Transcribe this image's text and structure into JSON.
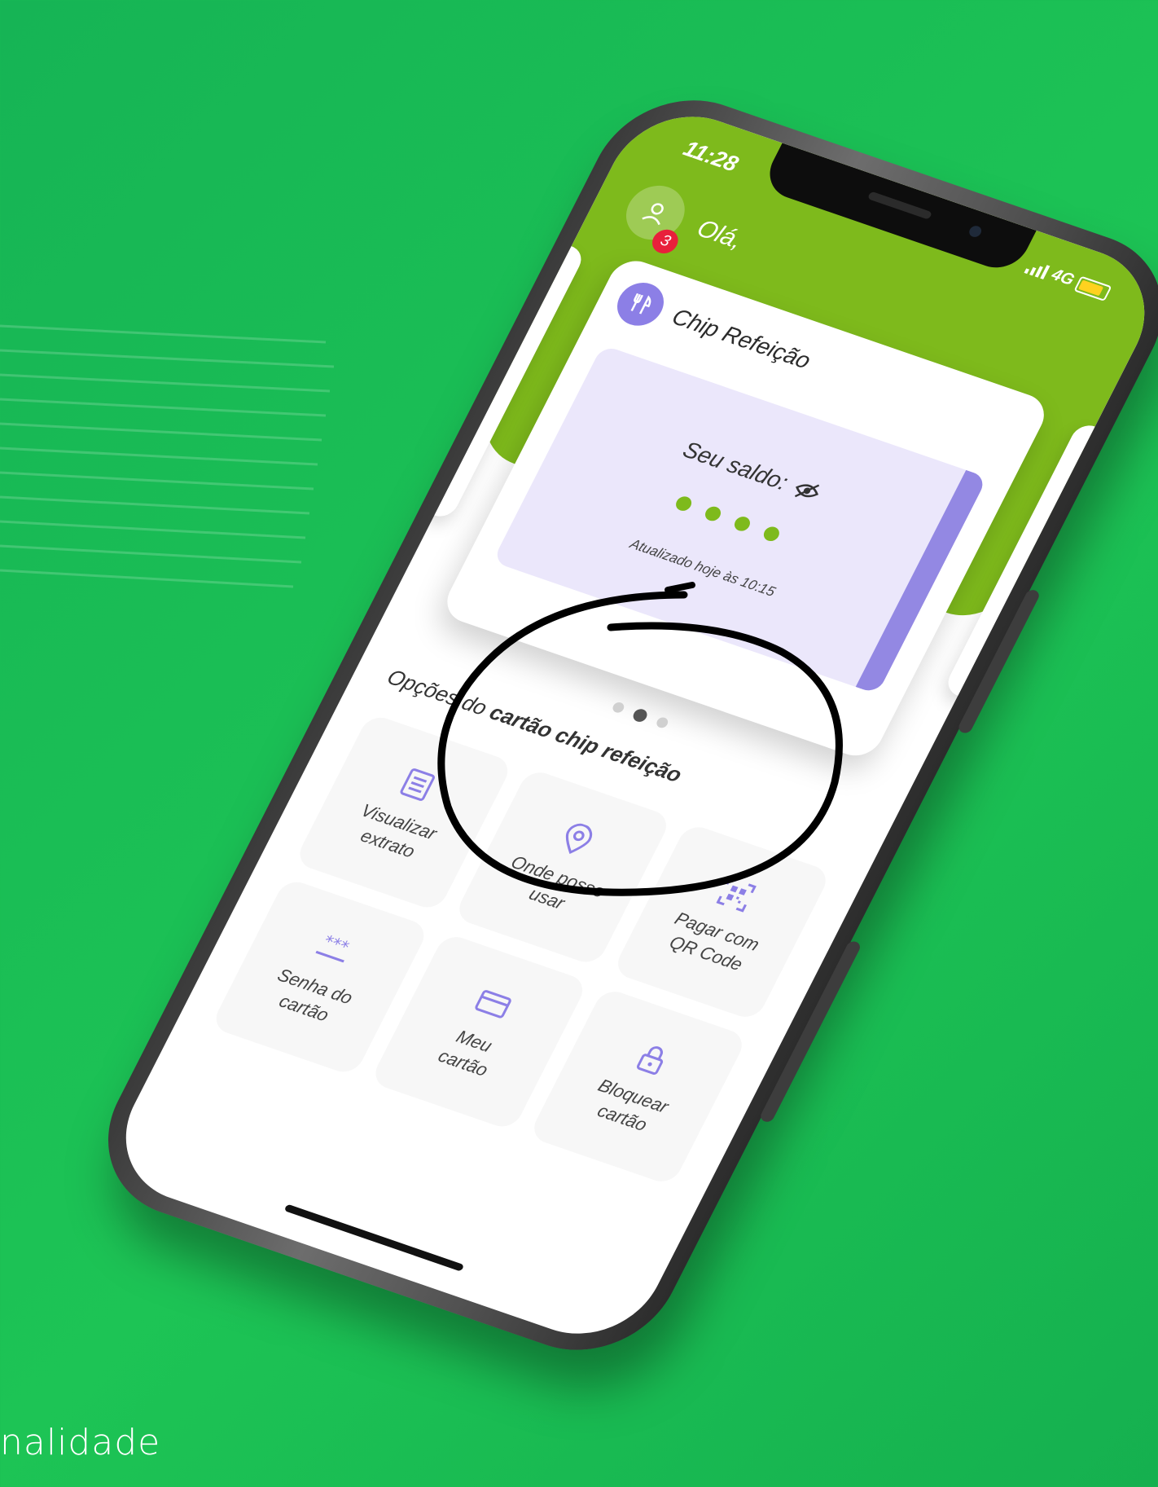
{
  "status_bar": {
    "time": "11:28",
    "network": "4G"
  },
  "header": {
    "greeting": "Olá,",
    "notification_count": "3"
  },
  "card": {
    "title": "Chip Refeição",
    "balance_label": "Seu saldo:",
    "balance_hidden_dots": 4,
    "updated_text": "Atualizado hoje às 10:15"
  },
  "carousel": {
    "page_count": 3,
    "active_index": 1
  },
  "options": {
    "title_prefix": "Opções do ",
    "title_bold": "cartão chip refeição",
    "items": [
      {
        "label": "Visualizar\nextrato",
        "icon": "statement-icon"
      },
      {
        "label": "Onde posso\nusar",
        "icon": "location-pin-icon"
      },
      {
        "label": "Pagar com\nQR Code",
        "icon": "qr-code-icon"
      },
      {
        "label": "Senha do\ncartão",
        "icon": "password-icon"
      },
      {
        "label": "Meu\ncartão",
        "icon": "card-icon"
      },
      {
        "label": "Bloquear\ncartão",
        "icon": "lock-icon"
      }
    ]
  },
  "footer_text": "nalidade",
  "colors": {
    "background_green": "#1dc455",
    "header_green": "#7eba1c",
    "accent_purple": "#8c7fe6",
    "balance_box": "#ebe7fb",
    "badge_red": "#e8203b"
  }
}
